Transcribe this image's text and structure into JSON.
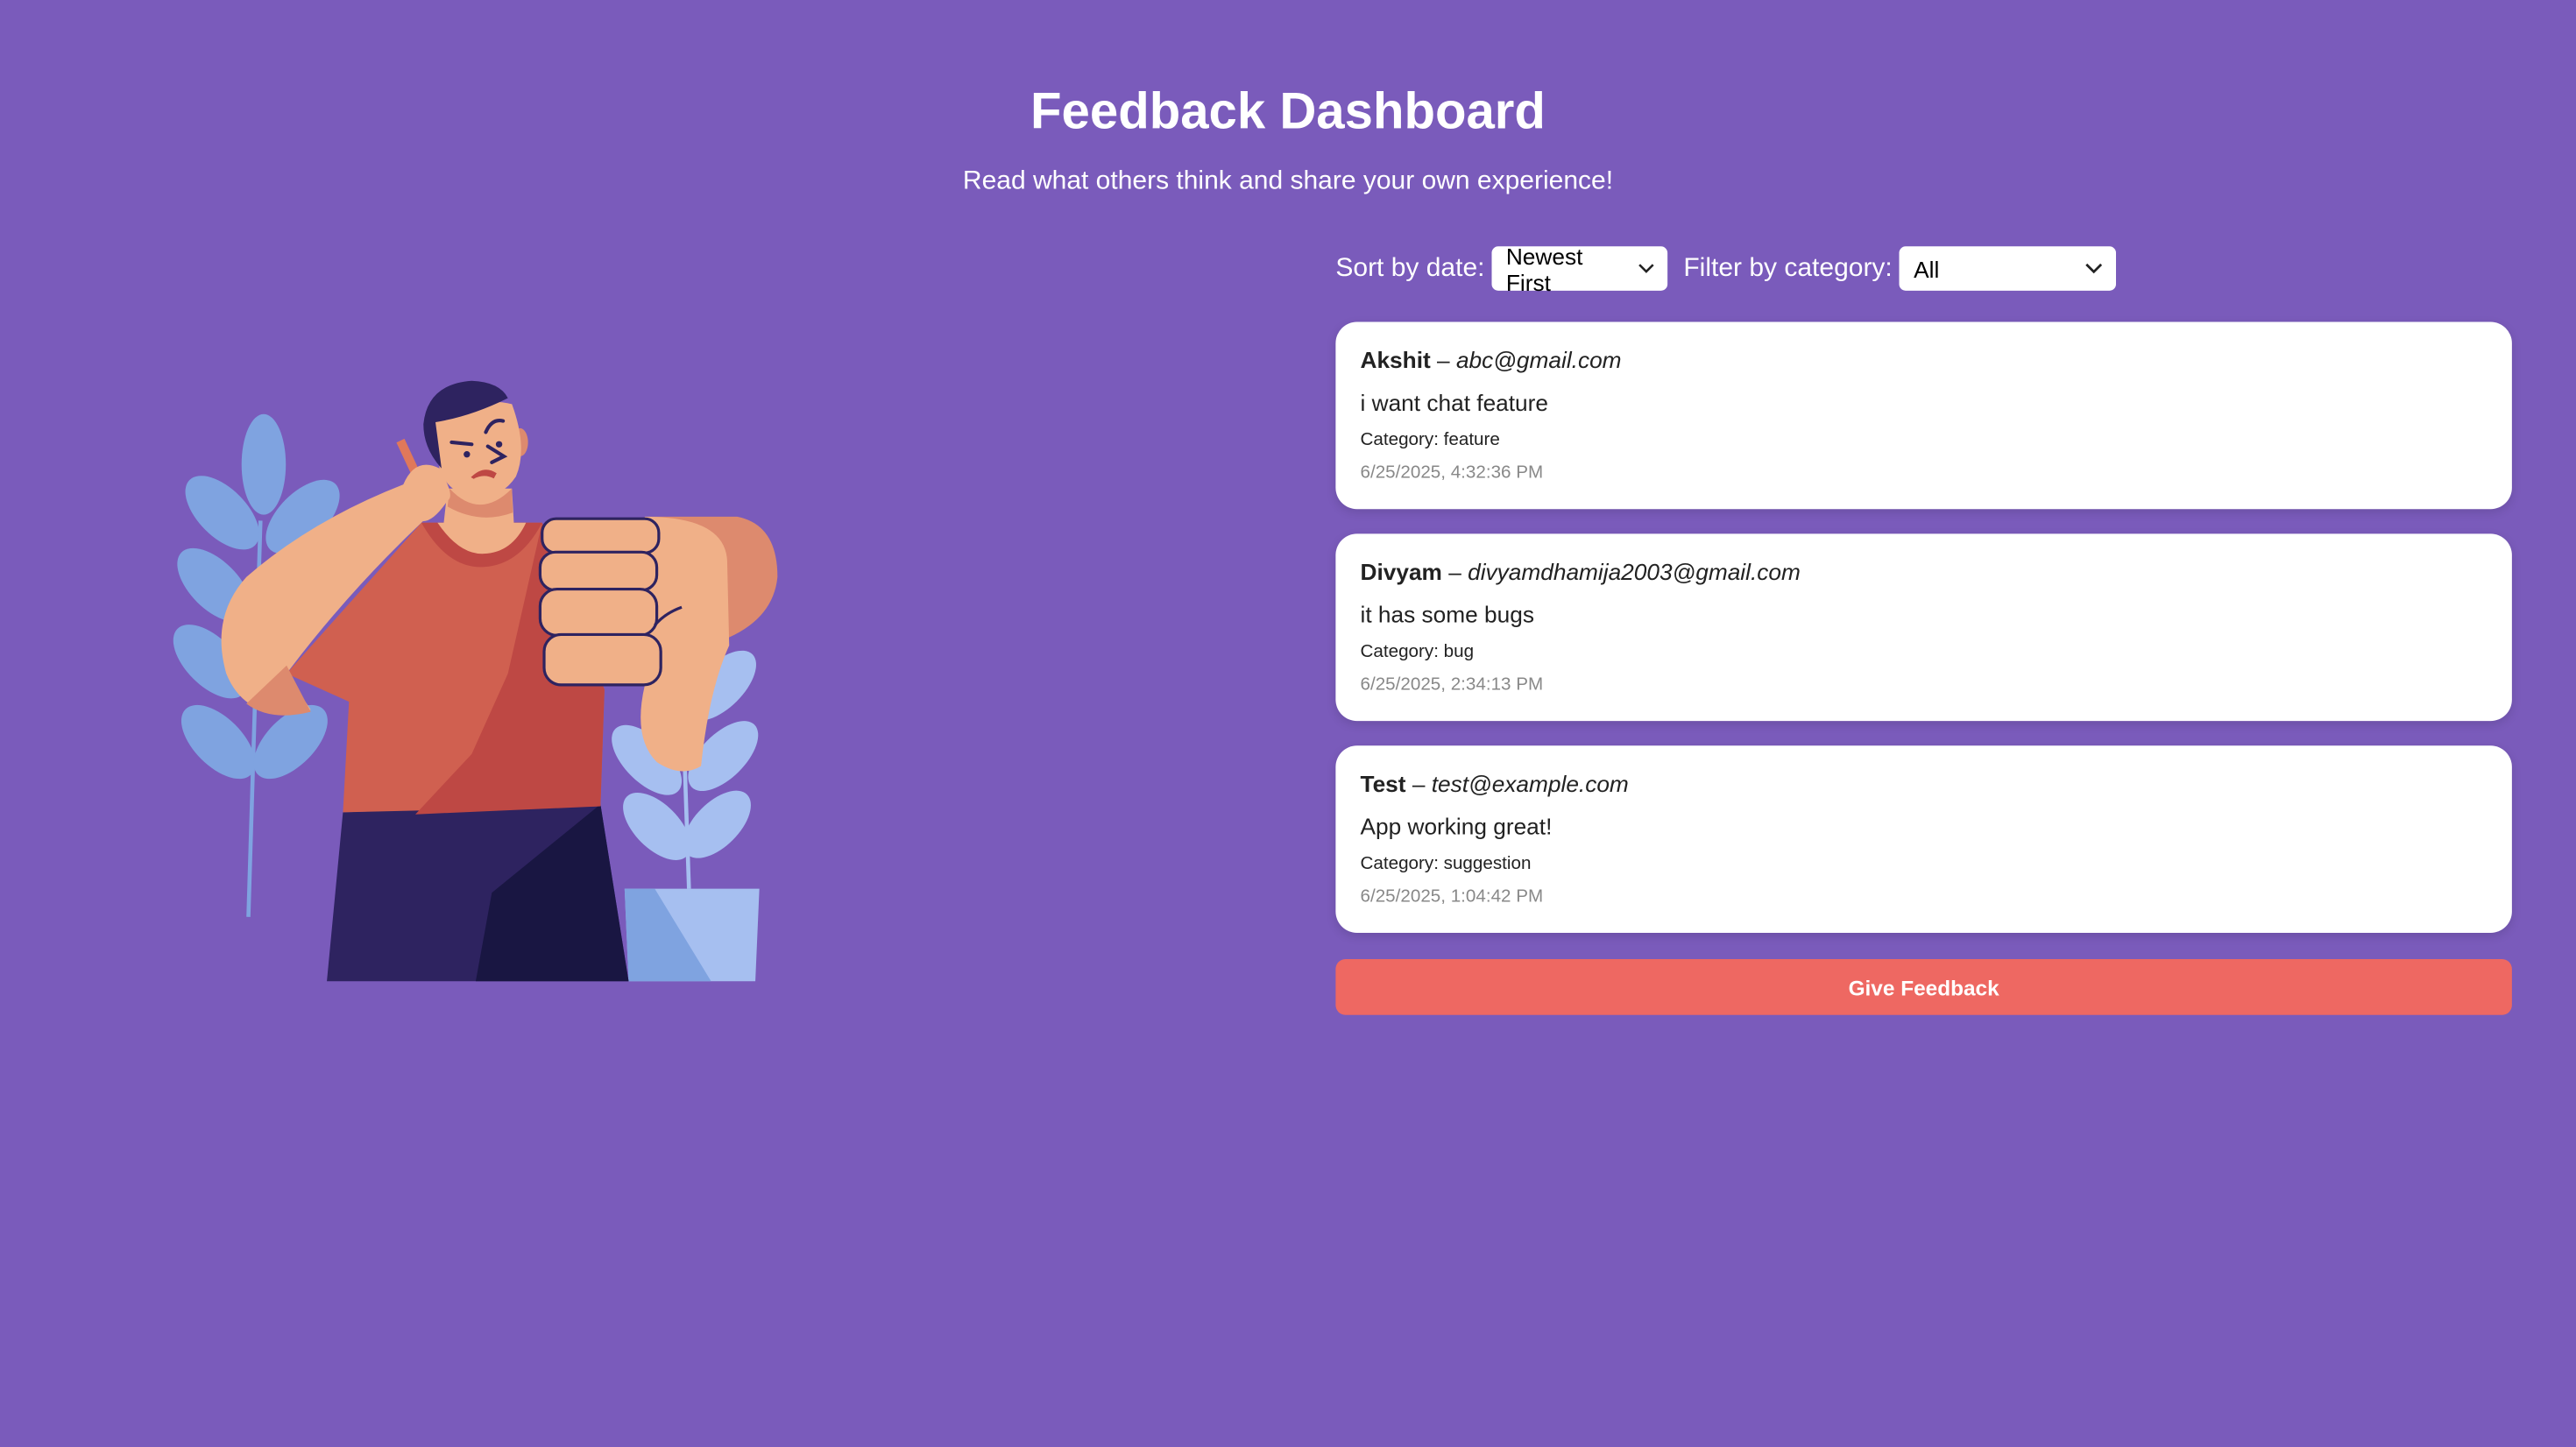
{
  "header": {
    "title": "Feedback Dashboard",
    "subtitle": "Read what others think and share your own experience!"
  },
  "controls": {
    "sort_label": "Sort by date:",
    "sort_value": "Newest First",
    "filter_label": "Filter by category:",
    "filter_value": "All"
  },
  "feedback": [
    {
      "name": "Akshit",
      "separator": " – ",
      "email": "abc@gmail.com",
      "message": "i want chat feature",
      "category": "Category: feature",
      "date": "6/25/2025, 4:32:36 PM"
    },
    {
      "name": "Divyam",
      "separator": " – ",
      "email": "divyamdhamija2003@gmail.com",
      "message": "it has some bugs",
      "category": "Category: bug",
      "date": "6/25/2025, 2:34:13 PM"
    },
    {
      "name": "Test",
      "separator": " – ",
      "email": "test@example.com",
      "message": "App working great!",
      "category": "Category: suggestion",
      "date": "6/25/2025, 1:04:42 PM"
    }
  ],
  "actions": {
    "give_feedback": "Give Feedback"
  },
  "colors": {
    "background": "#7a5bbb",
    "accent_button": "#ee6862",
    "card": "#ffffff"
  },
  "icons": {
    "select_arrow": "chevron-down-icon",
    "illustration": "person-thumbs-down-illustration"
  }
}
